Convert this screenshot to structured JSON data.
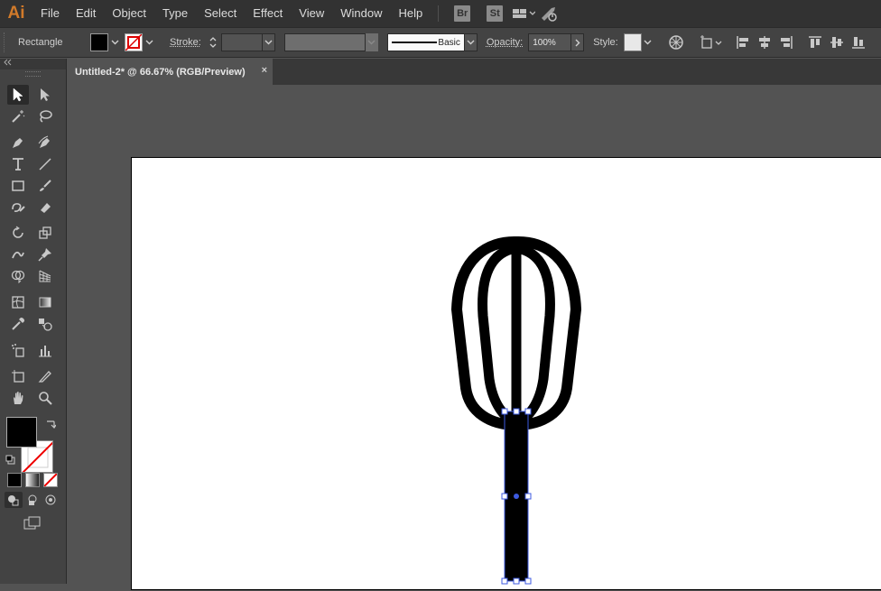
{
  "menubar": {
    "logo": "Ai",
    "items": [
      "File",
      "Edit",
      "Object",
      "Type",
      "Select",
      "Effect",
      "View",
      "Window",
      "Help"
    ],
    "bridge_badge": "Br",
    "stock_badge": "St"
  },
  "controlbar": {
    "selection_type": "Rectangle",
    "stroke_label": "Stroke:",
    "stroke_weight": "",
    "brush_profile": "Basic",
    "opacity_label": "Opacity:",
    "opacity_value": "100%",
    "style_label": "Style:"
  },
  "document": {
    "tab_title": "Untitled-2* @ 66.67% (RGB/Preview)",
    "close_glyph": "×"
  },
  "colors": {
    "fill": "#000000",
    "stroke": "none",
    "selection": "#3d5ae0",
    "app_bg": "#535353"
  }
}
